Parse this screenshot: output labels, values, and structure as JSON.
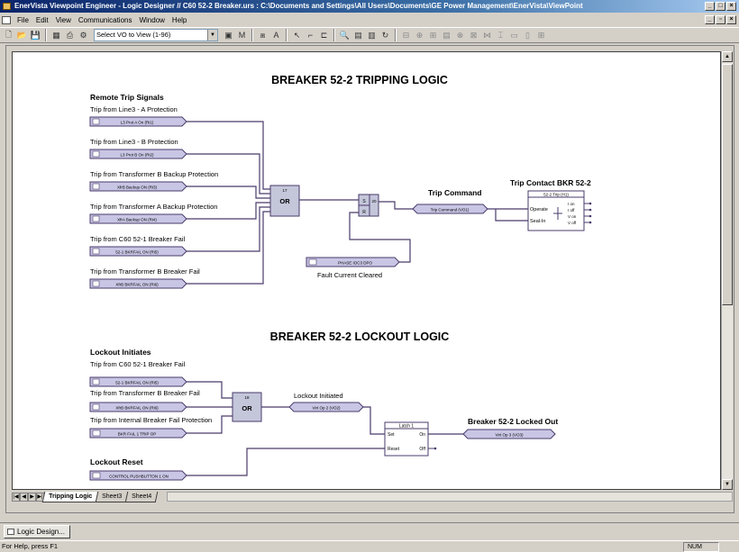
{
  "window": {
    "title": "EnerVista Viewpoint Engineer - Logic Designer // C60 52-2 Breaker.urs : C:\\Documents and Settings\\All Users\\Documents\\GE Power Management\\EnerVista\\ViewPoint"
  },
  "menu": {
    "items": [
      "File",
      "Edit",
      "View",
      "Communications",
      "Window",
      "Help"
    ]
  },
  "toolbar": {
    "vo_select": "Select VO to View (1-96)"
  },
  "diagram": {
    "tripping": {
      "title": "BREAKER 52-2 TRIPPING LOGIC",
      "remote_header": "Remote Trip  Signals",
      "inputs": [
        {
          "label": "Trip from Line3 - A Protection",
          "operand": "L3 Prot A On (Ri1)"
        },
        {
          "label": "Trip from Line3 - B Protection",
          "operand": "L3 Prot B On (Ri2)"
        },
        {
          "label": "Trip from Transformer B Backup Protection",
          "operand": "XfrB Backup ON (Ri3)"
        },
        {
          "label": "Trip from Transformer A Backup Protection",
          "operand": "XfrA Backup ON (Ri4)"
        },
        {
          "label": "Trip from C60 52-1 Breaker Fail",
          "operand": "52-1 BKRFAIL ON (Ri5)"
        },
        {
          "label": "Trip from Transformer B Breaker Fail",
          "operand": "XfrB BKRFAIL ON (Ri6)"
        }
      ],
      "or_gate": {
        "number": "17",
        "label": "OR"
      },
      "sr_latch": {
        "number": "20",
        "set": "S",
        "reset": "R"
      },
      "trip_command": {
        "label": "Trip Command",
        "operand": "Trip Command (VO1)"
      },
      "fault_cleared": {
        "operand": "PHASE IOC3 DPO",
        "label": "Fault Current Cleared"
      },
      "contact": {
        "title": "Trip Contact BKR 52-2",
        "header": "52-2 Trip (H1)",
        "operate": "Operate",
        "seal_in": "Seal-In",
        "states": [
          "I on",
          "I off",
          "V on",
          "V off"
        ]
      }
    },
    "lockout": {
      "title": "BREAKER 52-2 LOCKOUT LOGIC",
      "initiates_header": "Lockout Initiates",
      "inputs": [
        {
          "label": "Trip from C60 52-1 Breaker Fail",
          "operand": "52-1 BKRFAIL ON (Ri5)"
        },
        {
          "label": "Trip from Transformer B Breaker Fail",
          "operand": "XfrB BKRFAIL ON (Ri6)"
        },
        {
          "label": "Trip from Internal Breaker Fail Protection",
          "operand": "BKR FAIL 1 TRIP OP"
        }
      ],
      "or_gate": {
        "number": "18",
        "label": "OR"
      },
      "lockout_initiated": {
        "label": "Lockout Initiated",
        "operand": "Virt Op 2 (VO2)"
      },
      "latch": {
        "title": "Latch 1",
        "set": "Set",
        "reset": "Reset",
        "on": "On",
        "off": "Off"
      },
      "locked_out": {
        "label": "Breaker 52-2 Locked Out",
        "operand": "Virt Op 3 (VO3)"
      },
      "reset_header": "Lockout Reset",
      "reset_operand": "CONTROL PUSHBUTTON 1 ON"
    }
  },
  "sheets": {
    "tabs": [
      "Tripping Logic",
      "Sheet3",
      "Sheet4"
    ]
  },
  "taskbar": {
    "tab_label": "Logic Design..."
  },
  "status": {
    "text": "For Help, press F1",
    "num": "NUM"
  },
  "colors": {
    "wire": "#4a3b6b",
    "operand_fill": "#c8c6e4",
    "gate_fill": "#c4c6da"
  }
}
